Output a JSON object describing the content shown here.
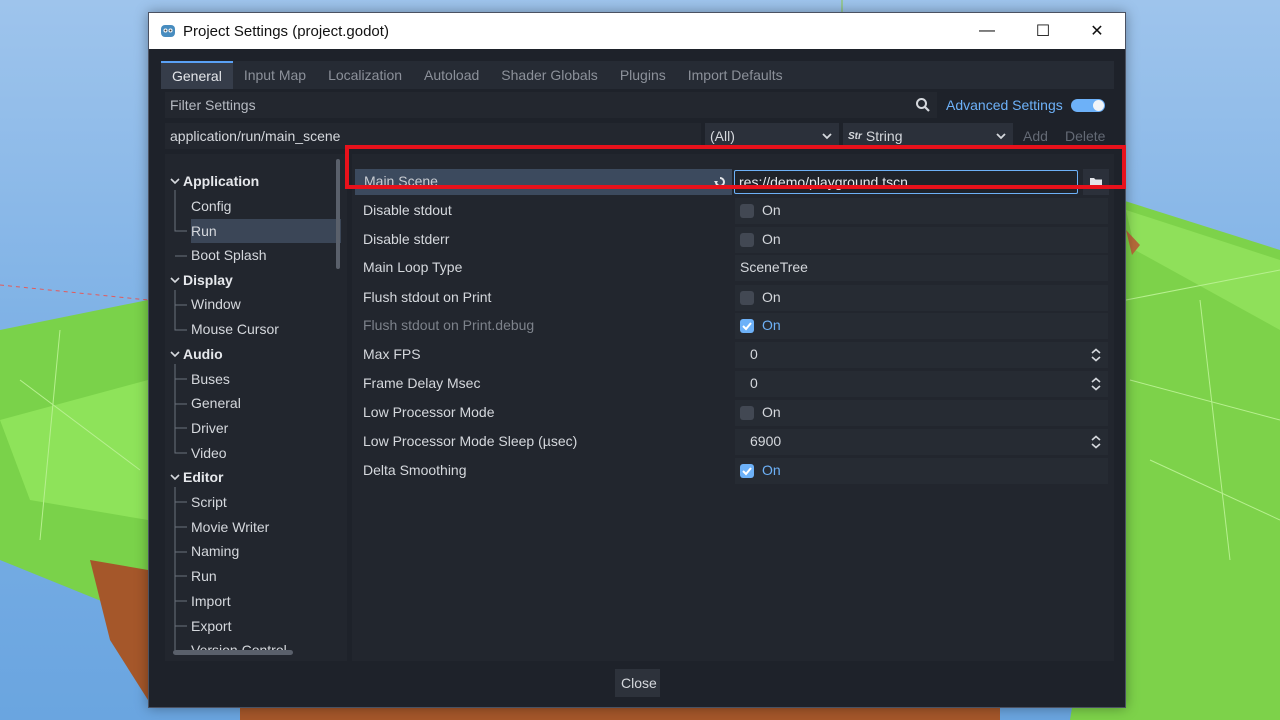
{
  "window": {
    "title": "Project Settings (project.godot)",
    "controls": {
      "minimize": "—",
      "maximize": "☐",
      "close": "✕"
    }
  },
  "tabs": [
    "General",
    "Input Map",
    "Localization",
    "Autoload",
    "Shader Globals",
    "Plugins",
    "Import Defaults"
  ],
  "active_tab": "General",
  "filter": {
    "placeholder": "Filter Settings",
    "advanced_label": "Advanced Settings",
    "advanced_enabled": true
  },
  "add_property": {
    "path_value": "application/run/main_scene",
    "category": "(All)",
    "type_icon": "Str",
    "type": "String",
    "add_label": "Add",
    "delete_label": "Delete"
  },
  "sidebar": {
    "sections": [
      {
        "label": "Application",
        "items": [
          "Config",
          "Run",
          "Boot Splash"
        ]
      },
      {
        "label": "Display",
        "items": [
          "Window",
          "Mouse Cursor"
        ]
      },
      {
        "label": "Audio",
        "items": [
          "Buses",
          "General",
          "Driver",
          "Video"
        ]
      },
      {
        "label": "Editor",
        "items": [
          "Script",
          "Movie Writer",
          "Naming",
          "Run",
          "Import",
          "Export",
          "Version Control"
        ]
      }
    ],
    "selected": "Application/Run"
  },
  "properties": {
    "main_scene": {
      "label": "Main Scene",
      "value": "res://demo/playground.tscn"
    },
    "rows": [
      {
        "label": "Disable stdout",
        "kind": "check",
        "checked": false,
        "text": "On"
      },
      {
        "label": "Disable stderr",
        "kind": "check",
        "checked": false,
        "text": "On"
      },
      {
        "label": "Main Loop Type",
        "kind": "text",
        "text": "SceneTree"
      },
      {
        "label": "Flush stdout on Print",
        "kind": "check",
        "checked": false,
        "text": "On"
      },
      {
        "label": "Flush stdout on Print.debug",
        "kind": "check",
        "checked": true,
        "text": "On",
        "dim": true
      },
      {
        "label": "Max FPS",
        "kind": "number",
        "text": "0"
      },
      {
        "label": "Frame Delay Msec",
        "kind": "number",
        "text": "0"
      },
      {
        "label": "Low Processor Mode",
        "kind": "check",
        "checked": false,
        "text": "On"
      },
      {
        "label": "Low Processor Mode Sleep (µsec)",
        "kind": "number",
        "text": "6900"
      },
      {
        "label": "Delta Smoothing",
        "kind": "check",
        "checked": true,
        "text": "On"
      }
    ]
  },
  "footer": {
    "close_label": "Close"
  },
  "colors": {
    "accent": "#6db1f8",
    "highlight": "#e8111b",
    "panel": "#22262e",
    "window": "#1e222a"
  }
}
